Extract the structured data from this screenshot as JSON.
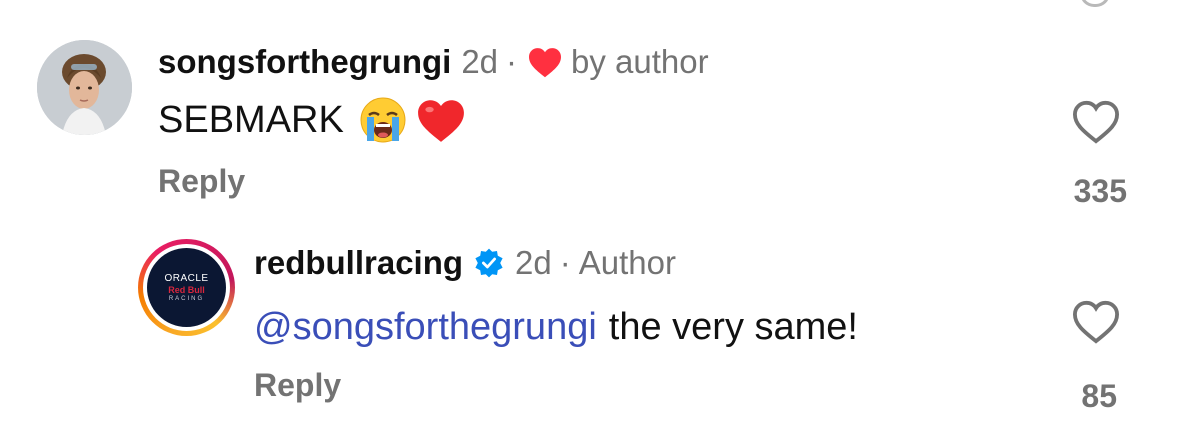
{
  "comments": [
    {
      "username": "songsforthegrungi",
      "age": "2d",
      "separator": "·",
      "author_liked_label": "by author",
      "text": "SEBMARK",
      "emojis": [
        "loudly-crying-face-icon",
        "red-heart-icon"
      ],
      "reply_label": "Reply",
      "like_count": "335",
      "avatar": "user-photo"
    },
    {
      "username": "redbullracing",
      "verified": true,
      "age": "2d",
      "separator": "·",
      "author_label": "Author",
      "mention": "@songsforthegrungi",
      "text": "the very same!",
      "reply_label": "Reply",
      "like_count": "85",
      "avatar": "oracle-red-bull-racing-logo",
      "logo_text": [
        "ORACLE",
        "Red Bull",
        "RACING"
      ]
    }
  ],
  "colors": {
    "text_primary": "#111111",
    "text_secondary": "#737373",
    "mention": "#3a4eb8",
    "verified_blue": "#0095f6",
    "heart_red": "#ff3040",
    "background": "#ffffff"
  }
}
